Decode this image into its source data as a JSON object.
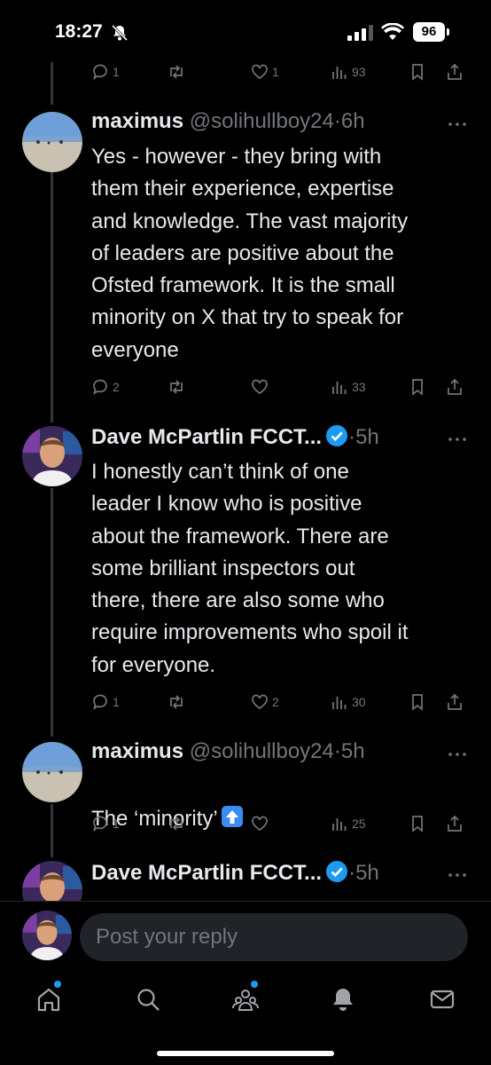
{
  "status": {
    "time": "18:27",
    "battery": "96"
  },
  "post0": {
    "reply_count": "1",
    "retweet_count": "",
    "like_count": "1",
    "view_count": "93"
  },
  "posts": [
    {
      "name": "maximus",
      "handle": "@solihullboy24",
      "time": "6h",
      "text": "Yes - however - they bring with\nthem their experience, expertise\nand knowledge. The vast majority\nof leaders are positive about the\nOfsted framework. It is the small\nminority on X that try to speak for\neveryone",
      "reply_count": "2",
      "like_count": "",
      "view_count": "33"
    },
    {
      "name": "Dave McPartlin FCCT...",
      "handle": "",
      "time": "5h",
      "text": "I honestly can’t think of one\nleader I know who is positive\nabout the framework. There are\nsome brilliant inspectors out\nthere, there are also some who\nrequire improvements who spoil it\nfor everyone.",
      "reply_count": "1",
      "like_count": "2",
      "view_count": "30"
    },
    {
      "name": "maximus",
      "handle": "@solihullboy24",
      "time": "5h",
      "text": "The ‘minority’",
      "reply_count": "1",
      "like_count": "",
      "view_count": "25"
    },
    {
      "name": "Dave McPartlin FCCT...",
      "handle": "",
      "time": "5h"
    }
  ],
  "reply": {
    "placeholder": "Post your reply"
  },
  "separator": "·",
  "colors": {
    "accent": "#1d9bf0",
    "muted": "#71767b",
    "text": "#e7e9ea",
    "background": "#000000"
  }
}
